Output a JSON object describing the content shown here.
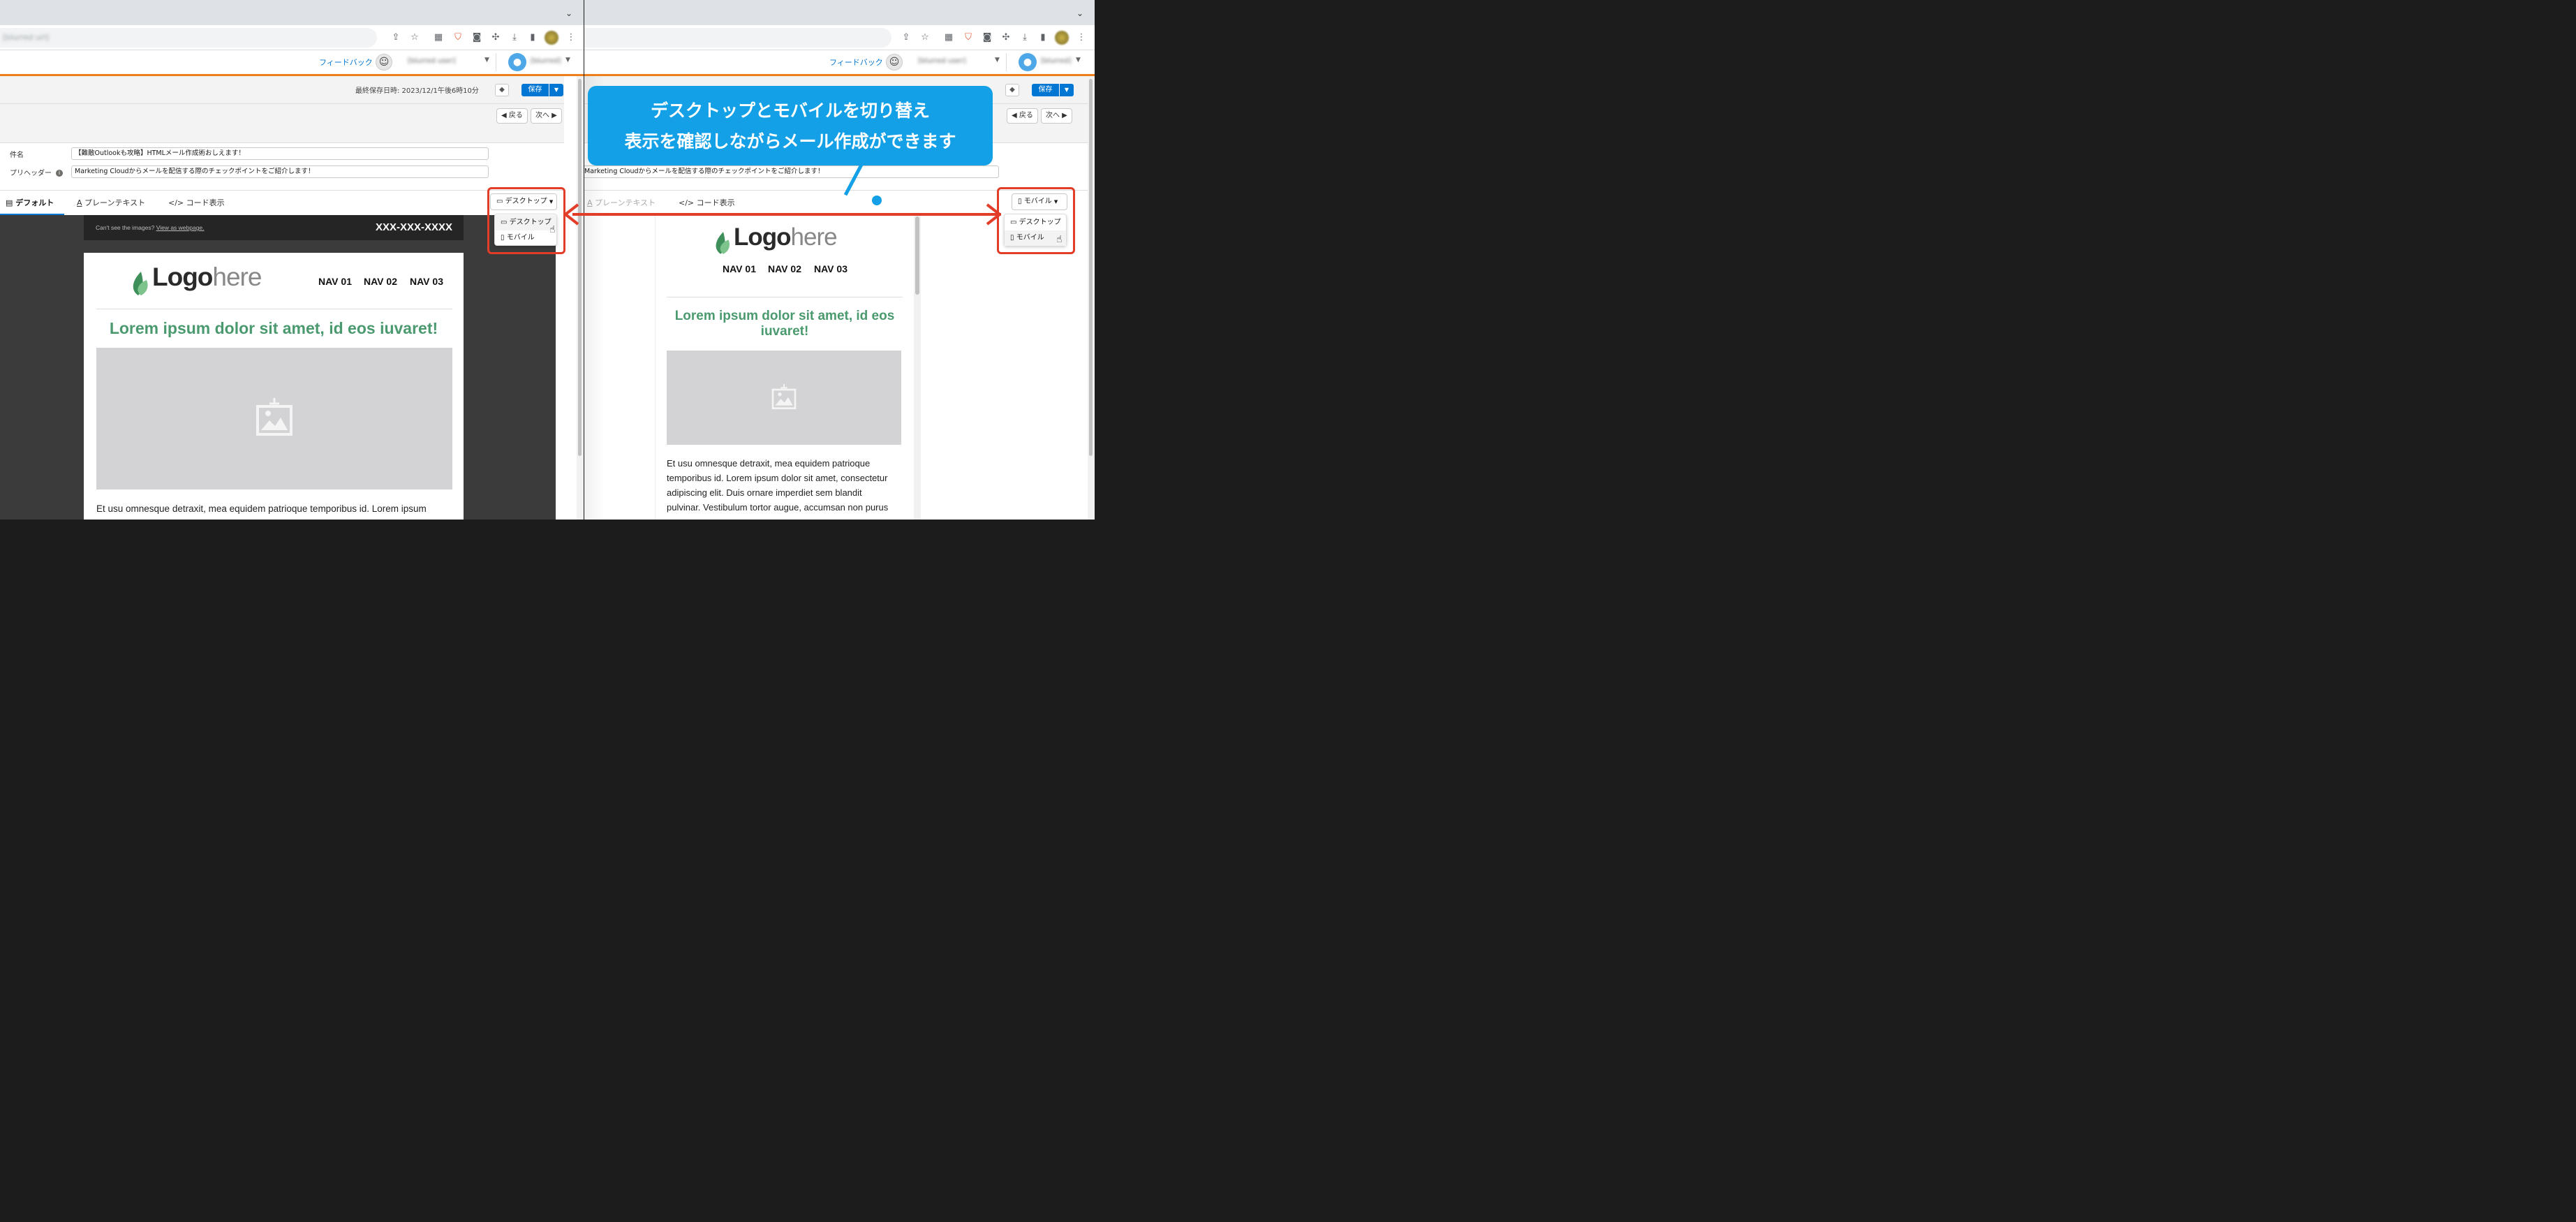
{
  "chrome": {
    "url_text": "[blurred url]"
  },
  "topbar": {
    "feedback_label": "フィードバック",
    "user_blurred": "[blurred user]",
    "user2_blurred": "[blurred]"
  },
  "editor": {
    "last_saved": "最終保存日時: 2023/12/1午後6時10分",
    "save_label": "保存",
    "back_label": "◀ 戻る",
    "next_label": "次へ ▶"
  },
  "form": {
    "subject_label": "件名",
    "subject_value": "【難敵Outlookも攻略】HTMLメール作成術おしえます！",
    "preheader_label": "プリヘッダー",
    "preheader_value": "Marketing Cloudからメールを配信する際のチェックポイントをご紹介します！"
  },
  "tabs": [
    {
      "label": "デフォルト",
      "icon": "layout-icon"
    },
    {
      "label": "プレーンテキスト",
      "icon": "text-icon"
    },
    {
      "label": "コード表示",
      "icon": "code-icon"
    }
  ],
  "device_dropdown": {
    "left_selected": "デスクトップ",
    "right_selected": "モバイル",
    "options": [
      "デスクトップ",
      "モバイル"
    ]
  },
  "email": {
    "preheader_text": "Can't see the images?",
    "preheader_link": "View as webpage.",
    "phone": "XXX-XXX-XXXX",
    "logo_bold": "Logo",
    "logo_light": "here",
    "nav": [
      "NAV 01",
      "NAV 02",
      "NAV 03"
    ],
    "headline": "Lorem ipsum dolor sit amet, id eos iuvaret!",
    "headline_mobile_1": "Lorem ipsum dolor sit amet, id eos",
    "headline_mobile_2": "iuvaret!",
    "body_desktop_1": "Et usu omnesque detraxit, mea equidem patrioque temporibus id. Lorem ipsum",
    "body_mobile": [
      "Et usu omnesque detraxit, mea equidem patrioque",
      "temporibus id. Lorem ipsum dolor sit amet, consectetur",
      "adipiscing elit. Duis ornare imperdiet sem blandit",
      "pulvinar. Vestibulum tortor augue, accumsan non purus"
    ]
  },
  "callout": {
    "line1": "デスクトップとモバイルを切り替え",
    "line2": "表示を確認しながらメール作成ができます"
  },
  "colors": {
    "accent_blue": "#0176d3",
    "orange": "#ee7d1c",
    "callout_blue": "#14a0e6",
    "highlight_red": "#e23d28",
    "headline_green": "#4b9a6f"
  }
}
